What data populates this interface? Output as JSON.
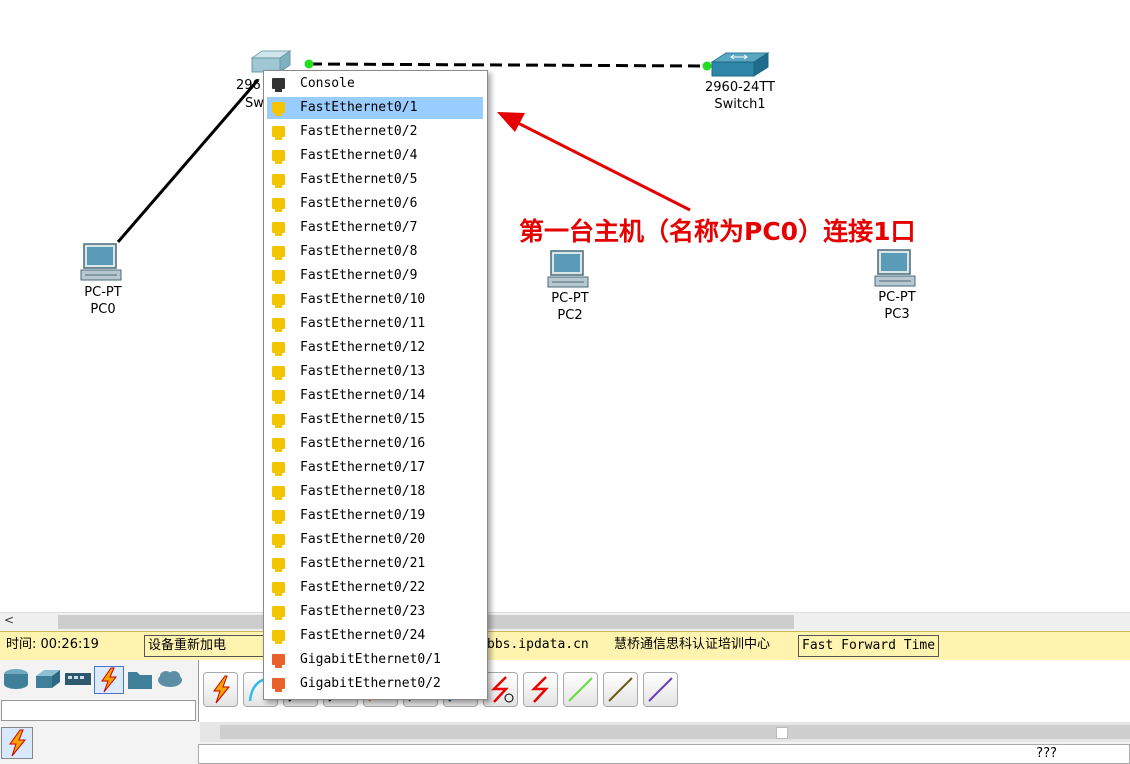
{
  "workspace": {
    "devices": [
      {
        "id": "switch0",
        "model": "296",
        "name": "Sw"
      },
      {
        "id": "switch1",
        "model": "2960-24TT",
        "name": "Switch1"
      },
      {
        "id": "pc0",
        "model": "PC-PT",
        "name": "PC0"
      },
      {
        "id": "pc2",
        "model": "PC-PT",
        "name": "PC2"
      },
      {
        "id": "pc3",
        "model": "PC-PT",
        "name": "PC3"
      }
    ],
    "annotation": "第一台主机（名称为PC0）连接1口"
  },
  "port_menu": {
    "selected_index": 1,
    "items": [
      {
        "label": "Console",
        "type": "console"
      },
      {
        "label": "FastEthernet0/1",
        "type": "fast"
      },
      {
        "label": "FastEthernet0/2",
        "type": "fast"
      },
      {
        "label": "FastEthernet0/4",
        "type": "fast"
      },
      {
        "label": "FastEthernet0/5",
        "type": "fast"
      },
      {
        "label": "FastEthernet0/6",
        "type": "fast"
      },
      {
        "label": "FastEthernet0/7",
        "type": "fast"
      },
      {
        "label": "FastEthernet0/8",
        "type": "fast"
      },
      {
        "label": "FastEthernet0/9",
        "type": "fast"
      },
      {
        "label": "FastEthernet0/10",
        "type": "fast"
      },
      {
        "label": "FastEthernet0/11",
        "type": "fast"
      },
      {
        "label": "FastEthernet0/12",
        "type": "fast"
      },
      {
        "label": "FastEthernet0/13",
        "type": "fast"
      },
      {
        "label": "FastEthernet0/14",
        "type": "fast"
      },
      {
        "label": "FastEthernet0/15",
        "type": "fast"
      },
      {
        "label": "FastEthernet0/16",
        "type": "fast"
      },
      {
        "label": "FastEthernet0/17",
        "type": "fast"
      },
      {
        "label": "FastEthernet0/18",
        "type": "fast"
      },
      {
        "label": "FastEthernet0/19",
        "type": "fast"
      },
      {
        "label": "FastEthernet0/20",
        "type": "fast"
      },
      {
        "label": "FastEthernet0/21",
        "type": "fast"
      },
      {
        "label": "FastEthernet0/22",
        "type": "fast"
      },
      {
        "label": "FastEthernet0/23",
        "type": "fast"
      },
      {
        "label": "FastEthernet0/24",
        "type": "fast"
      },
      {
        "label": "GigabitEthernet0/1",
        "type": "gigabit"
      },
      {
        "label": "GigabitEthernet0/2",
        "type": "gigabit"
      }
    ]
  },
  "status_bar": {
    "time_label": "时间: 00:26:19",
    "reload_label": "设备重新加电",
    "site": "bbs.ipdata.cn",
    "org": "慧桥通信思科认证培训中心",
    "fast_forward": "Fast Forward Time"
  },
  "bottom": {
    "description": "???"
  },
  "colors": {
    "console_port": "#333333",
    "fast_port": "#f5c400",
    "gigabit_port": "#e8602c",
    "selected_row": "#99ccff",
    "annotation": "#e60000",
    "status_bg": "#fff3b0",
    "link_up": "#22dd22"
  },
  "icons": {
    "categories": [
      "router-icon",
      "switch-icon",
      "hub-icon",
      "connections-icon",
      "folder-icon",
      "cloud-icon"
    ],
    "cables": [
      "auto-connect-icon",
      "console-cable-icon",
      "straight-cable-icon",
      "crossover-cable-icon",
      "fiber-cable-icon",
      "phone-cable-icon",
      "coaxial-cable-icon",
      "serial-dce-icon",
      "serial-dte-icon",
      "octal-cable-icon",
      "iot-cable-icon",
      "usb-cable-icon"
    ]
  }
}
